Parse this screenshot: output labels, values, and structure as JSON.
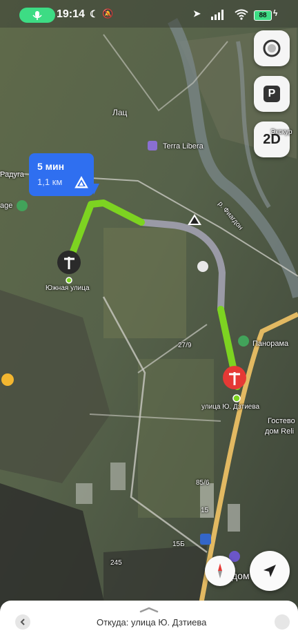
{
  "status_bar": {
    "time": "19:14",
    "battery": "88",
    "icons": [
      "mic-icon",
      "moon-icon",
      "mute-icon",
      "location-arrow-icon",
      "signal-icon",
      "wifi-icon",
      "battery-icon",
      "charging-icon"
    ]
  },
  "map_controls": {
    "alice_icon": "alice-assistant-icon",
    "parking_label": "P",
    "view_mode_label": "2D"
  },
  "route_info": {
    "time": "5 мин",
    "distance": "1,1 км",
    "warning_icon": "warning-triangle-icon"
  },
  "map_labels": {
    "lac": "Лац",
    "terra_libera": "Terra Libera",
    "raduga": "Радуга",
    "age": "age",
    "yuzhnaya": "Южная улица",
    "panorama": "Панорама",
    "dztieva": "улица Ю. Дзтиева",
    "guest_house_1": "Гостево",
    "guest_house_2": "дом Reli",
    "house_279": "27/9",
    "house_85_6": "85/6",
    "house_15": "15",
    "house_15b": "15Б",
    "house_245": "245",
    "dom": "дом",
    "river": "р. Фиагдон",
    "ekskurs": "Экскур"
  },
  "bottom_sheet": {
    "from_text": "Откуда: улица Ю. Дзтиева"
  },
  "colors": {
    "route_green": "#7dd321",
    "route_gray": "#9a9aa6",
    "accent_blue": "#2f6ff0",
    "pin_red": "#e53935",
    "pin_dark": "#2a2a2a"
  }
}
